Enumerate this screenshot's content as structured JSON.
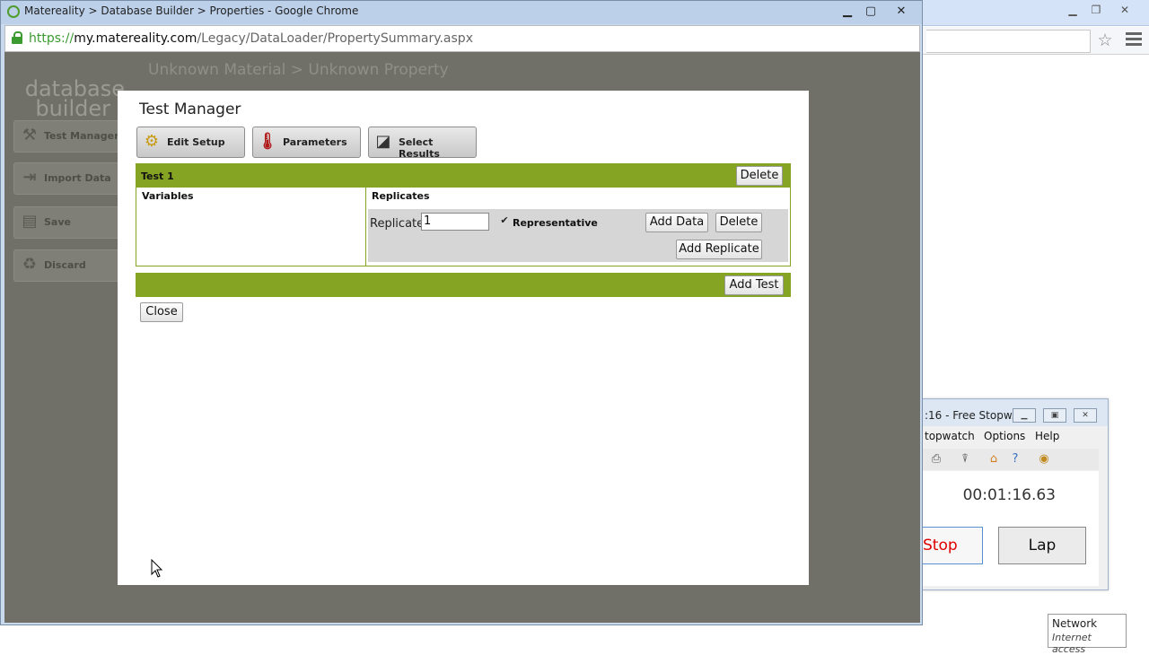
{
  "main_window": {
    "title": "Matereality > Database Builder > Properties - Google Chrome",
    "url_scheme": "https://",
    "url_host": "my.matereality.com",
    "url_path": "/Legacy/DataLoader/PropertySummary.aspx",
    "controls": {
      "minimize": "▁",
      "maximize": "▢",
      "close": "✕"
    }
  },
  "page": {
    "logo_line1": "database",
    "logo_line2": "builder",
    "breadcrumb": "Unknown Material > Unknown Property",
    "sidebar": [
      {
        "label": "Test Manager",
        "icon": "wrench-icon",
        "glyph": "⚒"
      },
      {
        "label": "Import Data",
        "icon": "import-icon",
        "glyph": "⇥"
      },
      {
        "label": "Save",
        "icon": "save-icon",
        "glyph": "▤"
      },
      {
        "label": "Discard",
        "icon": "trash-icon",
        "glyph": "♻"
      }
    ]
  },
  "modal": {
    "title": "Test Manager",
    "toolbar": {
      "edit_setup": "Edit Setup",
      "parameters": "Parameters",
      "select_results": "Select Results"
    },
    "test": {
      "name": "Test 1",
      "delete_label": "Delete",
      "variables_header": "Variables",
      "replicates_header": "Replicates",
      "replicate_label": "Replicate",
      "replicate_value": "1",
      "representative_label": "Representative",
      "representative_checked": true,
      "add_data_label": "Add Data",
      "replicate_delete_label": "Delete",
      "add_replicate_label": "Add Replicate"
    },
    "add_test_label": "Add Test",
    "close_label": "Close"
  },
  "stopwatch": {
    "title": ":16 - Free Stopw...",
    "menu": [
      "topwatch",
      "Options",
      "Help"
    ],
    "time": "00:01:16.63",
    "stop_label": "Stop",
    "lap_label": "Lap"
  },
  "network_tooltip": {
    "title": "Network",
    "subtitle": "Internet access"
  },
  "colors": {
    "accent_green": "#86a424",
    "page_bg": "#707068",
    "lock_green": "#3b9b30",
    "stop_red": "#e00000"
  }
}
